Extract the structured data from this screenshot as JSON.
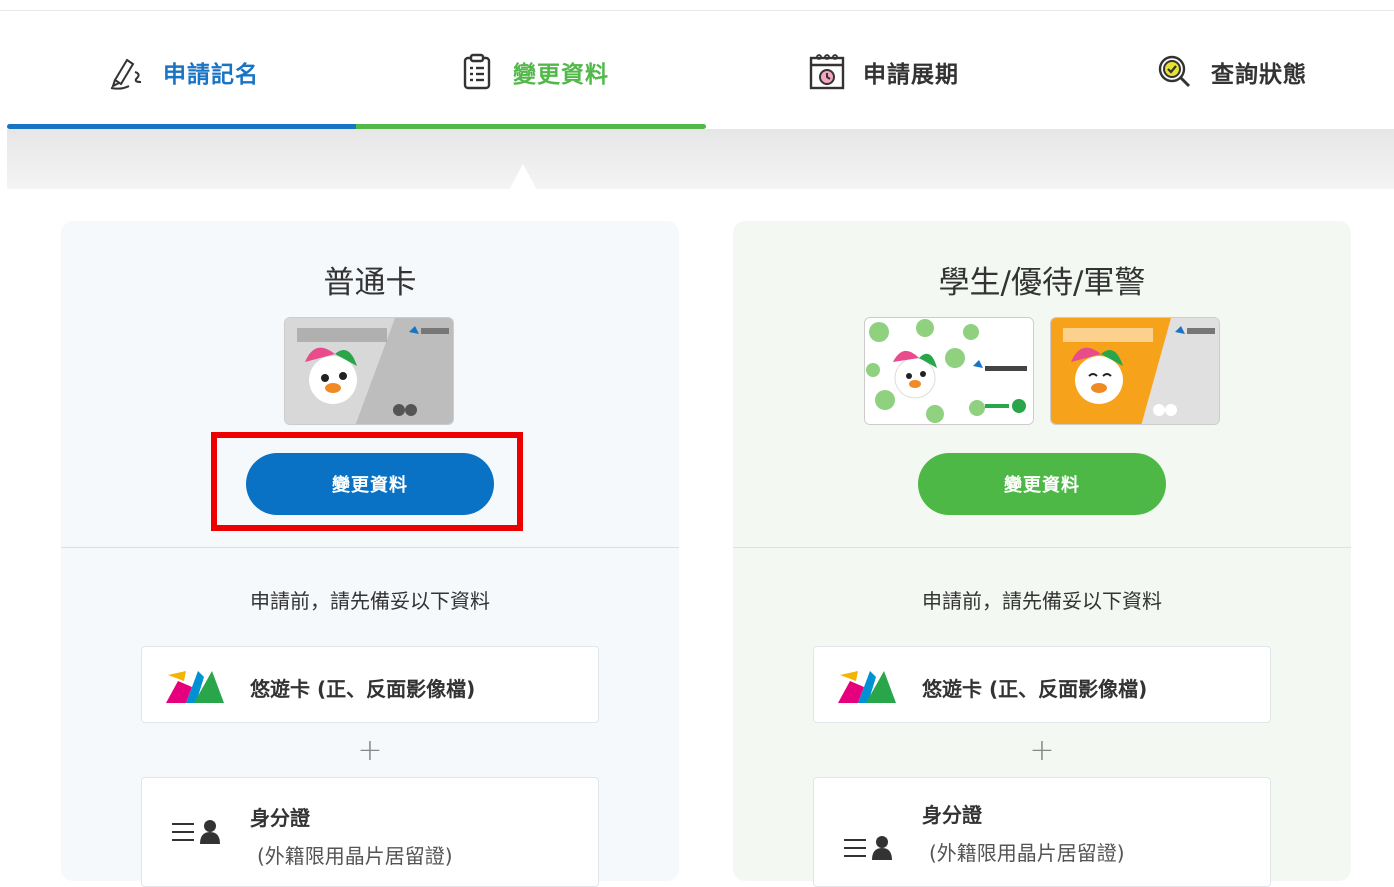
{
  "tabs": [
    {
      "label": "申請記名",
      "icon": "pen-icon"
    },
    {
      "label": "變更資料",
      "icon": "clipboard-icon"
    },
    {
      "label": "申請展期",
      "icon": "calendar-clock-icon"
    },
    {
      "label": "查詢狀態",
      "icon": "search-check-icon"
    }
  ],
  "colors": {
    "blue": "#0a72c4",
    "green": "#4db845",
    "highlight": "#ee0000"
  },
  "cards": [
    {
      "title": "普通卡",
      "button_label": "變更資料",
      "prep_title": "申請前，請先備妥以下資料",
      "items": [
        {
          "label": "悠遊卡 (正、反面影像檔)"
        },
        {
          "label": "身分證",
          "sub": "(外籍限用晶片居留證)"
        }
      ],
      "plus": "+"
    },
    {
      "title": "學生/優待/軍警",
      "button_label": "變更資料",
      "prep_title": "申請前，請先備妥以下資料",
      "items": [
        {
          "label": "悠遊卡 (正、反面影像檔)"
        },
        {
          "label": "身分證",
          "sub": "(外籍限用晶片居留證)"
        }
      ],
      "plus": "+"
    }
  ]
}
